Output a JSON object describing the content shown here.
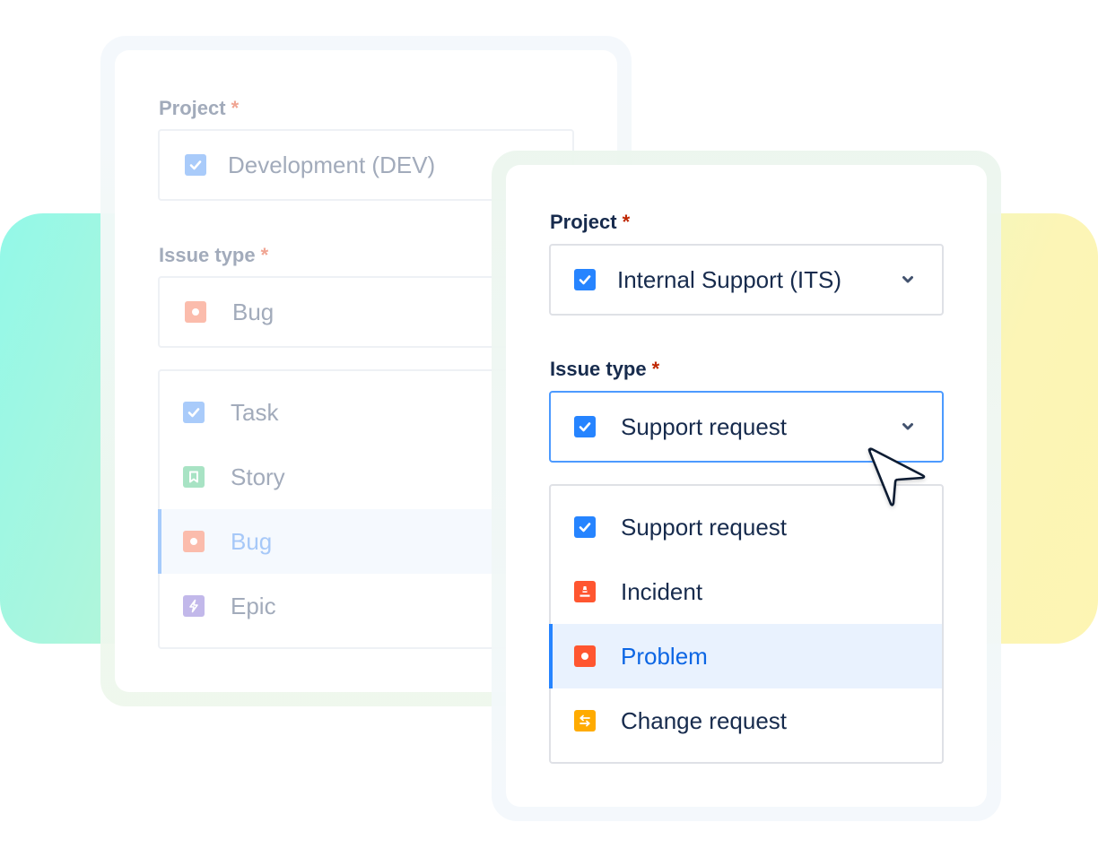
{
  "colors": {
    "brand_blue": "#2684ff",
    "selected_text": "#0c66e4",
    "selected_bg": "#e9f2fe",
    "incident_red": "#ff5630",
    "change_orange": "#ffab00",
    "story_green": "#a8e3c4",
    "epic_purple": "#c2b8ea"
  },
  "back_card": {
    "project": {
      "label": "Project",
      "required_mark": "*",
      "value": "Development (DEV)",
      "icon": "task-check-icon"
    },
    "issue_type": {
      "label": "Issue type",
      "required_mark": "*",
      "value": "Bug",
      "icon": "bug-icon"
    },
    "options": [
      {
        "label": "Task",
        "icon": "task-check-icon",
        "selected": false
      },
      {
        "label": "Story",
        "icon": "story-bookmark-icon",
        "selected": false
      },
      {
        "label": "Bug",
        "icon": "bug-icon",
        "selected": true
      },
      {
        "label": "Epic",
        "icon": "epic-lightning-icon",
        "selected": false
      }
    ]
  },
  "front_card": {
    "project": {
      "label": "Project",
      "required_mark": "*",
      "value": "Internal Support (ITS)",
      "icon": "task-check-icon"
    },
    "issue_type": {
      "label": "Issue type",
      "required_mark": "*",
      "value": "Support request",
      "icon": "task-check-icon"
    },
    "options": [
      {
        "label": "Support request",
        "icon": "support-request-check-icon",
        "selected": false
      },
      {
        "label": "Incident",
        "icon": "incident-cone-icon",
        "selected": false
      },
      {
        "label": "Problem",
        "icon": "problem-dot-icon",
        "selected": true
      },
      {
        "label": "Change request",
        "icon": "change-arrows-icon",
        "selected": false
      }
    ]
  }
}
